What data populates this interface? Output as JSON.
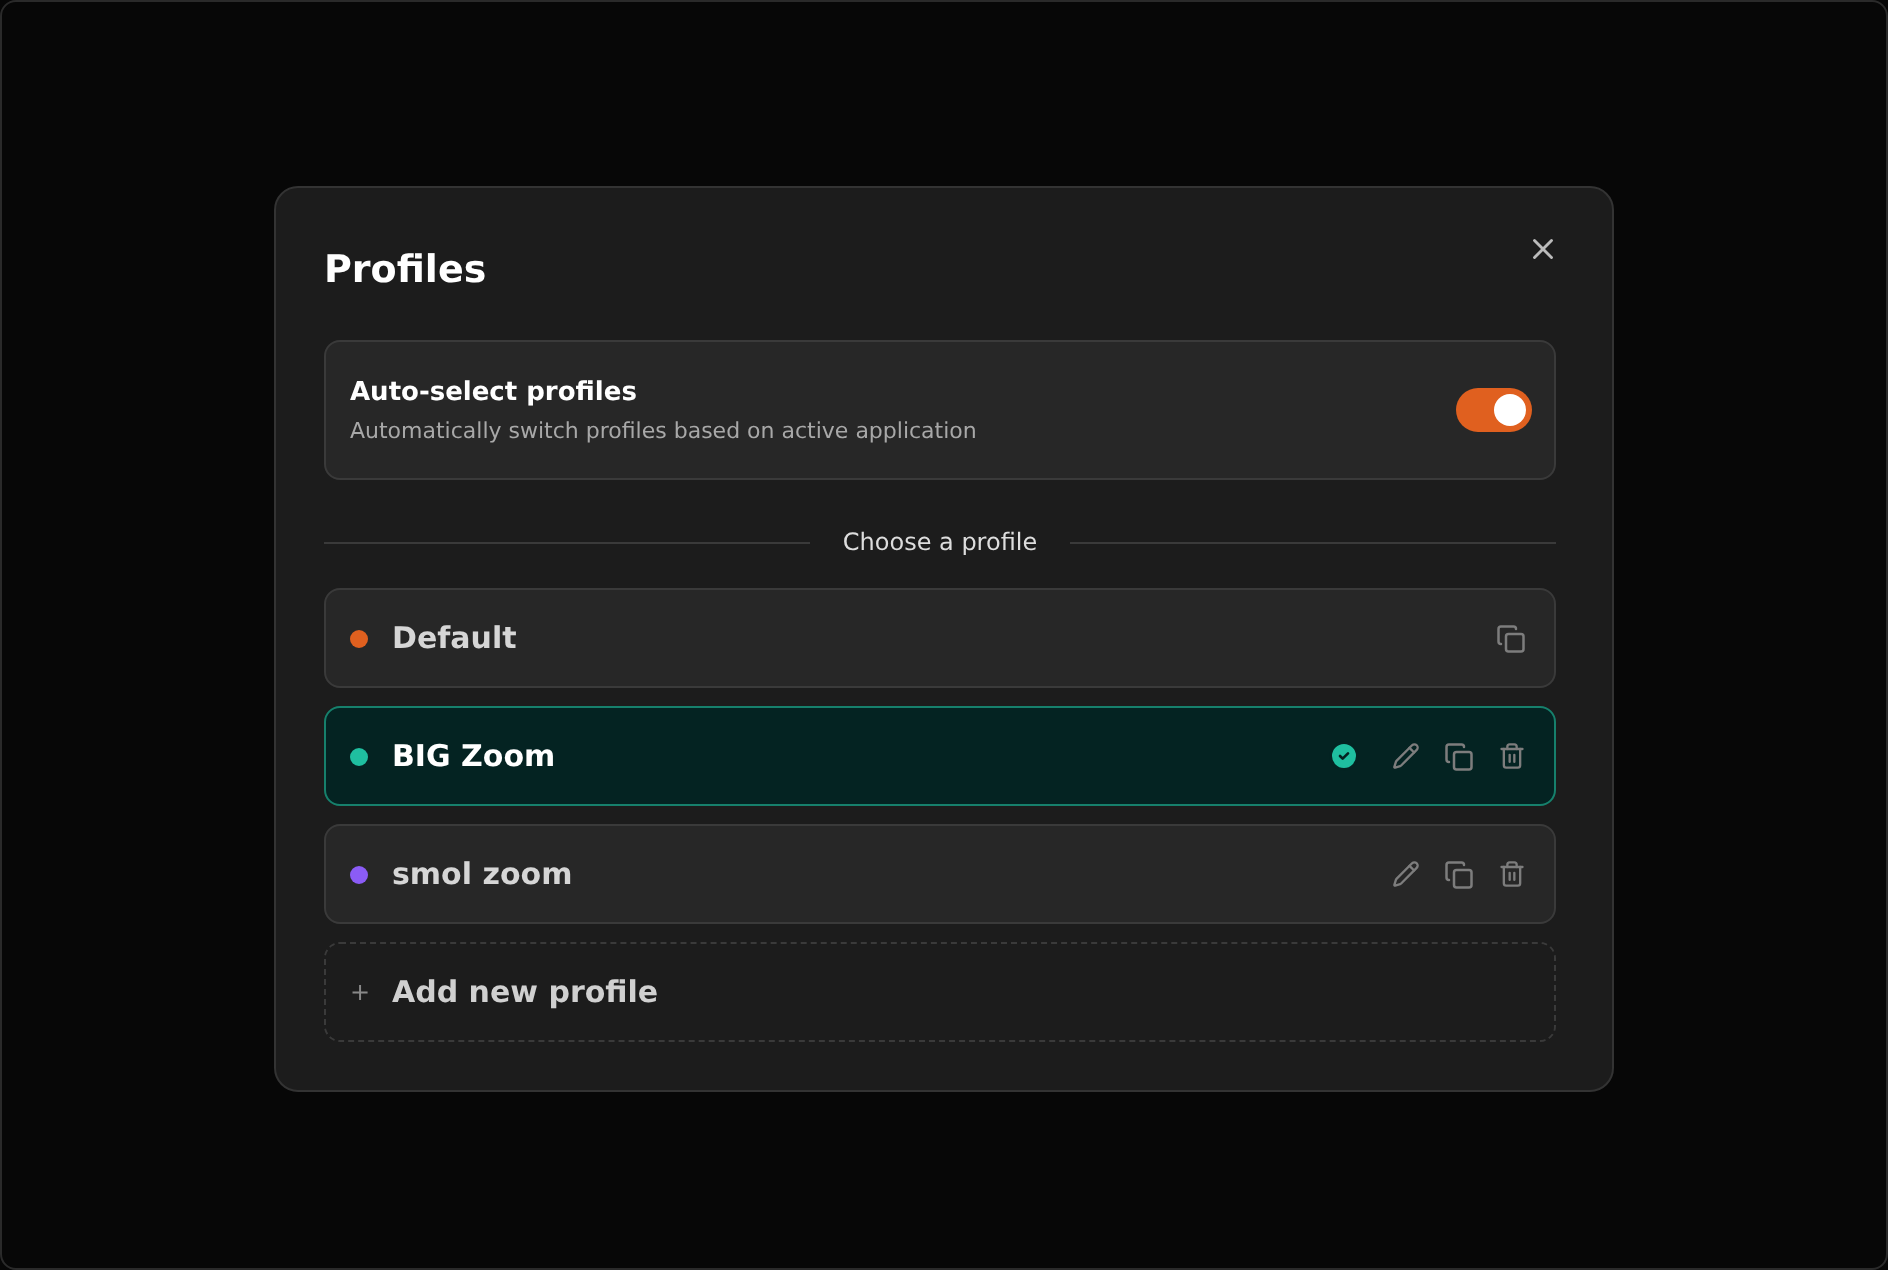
{
  "dialog": {
    "title": "Profiles",
    "auto_select": {
      "label": "Auto-select profiles",
      "description": "Automatically switch profiles based on active application",
      "on": true
    },
    "divider_label": "Choose a profile",
    "profiles": [
      {
        "name": "Default",
        "color": "#e0601f",
        "selected": false,
        "editable": false,
        "deletable": false
      },
      {
        "name": "BIG Zoom",
        "color": "#1fbfa0",
        "selected": true,
        "editable": true,
        "deletable": true
      },
      {
        "name": "smol zoom",
        "color": "#8b5cf6",
        "selected": false,
        "editable": true,
        "deletable": true
      }
    ],
    "add_label": "Add new profile",
    "add_icon": "+"
  }
}
